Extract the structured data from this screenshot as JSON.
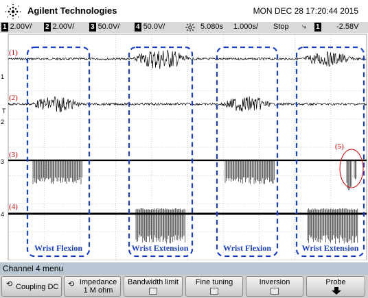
{
  "header": {
    "brand": "Agilent Technologies",
    "datetime": "MON DEC 28 17:20:44 2015"
  },
  "status": {
    "ch1_num": "1",
    "ch1_scale": "2.00V/",
    "ch2_num": "2",
    "ch2_scale": "2.00V/",
    "ch3_num": "3",
    "ch3_scale": "50.0V/",
    "ch4_num": "4",
    "ch4_scale": "50.0V/",
    "time_offset": "5.080s",
    "time_scale": "1.000s/",
    "run_state": "Stop",
    "trigger_source": "1",
    "trigger_level": "-2.58V"
  },
  "traces": [
    {
      "label": "(1)",
      "marker": "1"
    },
    {
      "label": "(2)",
      "marker": "2"
    },
    {
      "label": "(3)",
      "marker": "3"
    },
    {
      "label": "(4)",
      "marker": "4"
    }
  ],
  "trigger_marker": "T",
  "annotation_5": "(5)",
  "regions": [
    "Wrist Flexion",
    "Wrist Extension",
    "Wrist Flexion",
    "Wrist Extension"
  ],
  "menu": {
    "title": "Channel 4 menu"
  },
  "softkeys": {
    "coupling": "Coupling DC",
    "impedance_title": "Impedance",
    "impedance_value": "1 M ohm",
    "bandwidth": "Bandwidth limit",
    "fine": "Fine tuning",
    "inversion": "Inversion",
    "probe": "Probe"
  },
  "colors": {
    "region_box": "#1a3fc8",
    "trace_label": "#cc0000",
    "menu_bar": "#b8c6d4"
  }
}
